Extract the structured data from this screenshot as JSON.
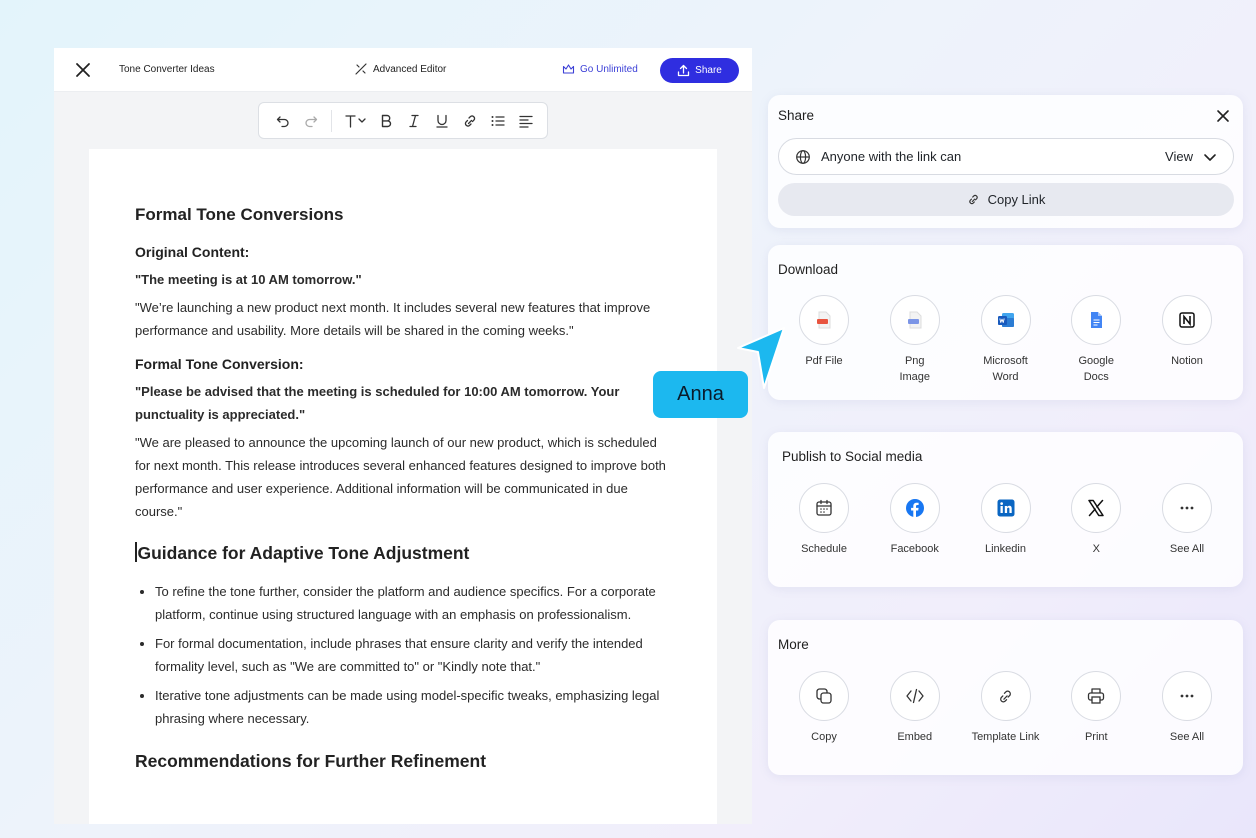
{
  "editor": {
    "doc_title": "Tone Converter Ideas",
    "advanced_editor": "Advanced Editor",
    "go_unlimited": "Go Unlimited",
    "share": "Share"
  },
  "document": {
    "h_formal": "Formal Tone Conversions",
    "original_heading": "Original Content:",
    "original_quote": "\"The meeting is at 10 AM tomorrow.\"",
    "original_para": "\"We’re launching a new product next month. It includes several new features that improve performance and usability. More details will be shared in the coming weeks.\"",
    "conversion_heading": "Formal Tone Conversion:",
    "conversion_quote": "\"Please be advised that the meeting is scheduled for 10:00 AM tomorrow. Your punctuality is appreciated.\"",
    "conversion_para": "\"We are pleased to announce the upcoming launch of our new product, which is scheduled for next month. This release introduces several enhanced features designed to improve both performance and user experience. Additional information will be communicated in due course.\"",
    "h_guidance": "Guidance for Adaptive Tone Adjustment",
    "bullets": [
      "To refine the tone further, consider the platform and audience specifics. For a corporate platform, continue using structured language with an emphasis on professionalism.",
      "For formal documentation, include phrases that ensure clarity and verify the intended formality level, such as \"We are committed to\" or \"Kindly note that.\"",
      "Iterative tone adjustments can be made using model-specific tweaks, emphasizing legal phrasing where necessary."
    ],
    "h_recommend": "Recommendations for Further Refinement"
  },
  "share_panel": {
    "title": "Share",
    "permission": "Anyone with the link can",
    "permission_value": "View",
    "copy_link": "Copy Link"
  },
  "download": {
    "title": "Download",
    "items": [
      {
        "label": "Pdf File",
        "icon": "pdf-file-icon"
      },
      {
        "label": "Png Image",
        "icon": "png-image-icon"
      },
      {
        "label": "Microsoft Word",
        "icon": "microsoft-word-icon"
      },
      {
        "label": "Google Docs",
        "icon": "google-docs-icon"
      },
      {
        "label": "Notion",
        "icon": "notion-icon"
      }
    ]
  },
  "social": {
    "title": "Publish to Social media",
    "items": [
      {
        "label": "Schedule",
        "icon": "calendar-icon"
      },
      {
        "label": "Facebook",
        "icon": "facebook-icon"
      },
      {
        "label": "Linkedin",
        "icon": "linkedin-icon"
      },
      {
        "label": "X",
        "icon": "x-icon"
      },
      {
        "label": "See All",
        "icon": "more-icon"
      }
    ]
  },
  "more": {
    "title": "More",
    "items": [
      {
        "label": "Copy",
        "icon": "copy-icon"
      },
      {
        "label": "Embed",
        "icon": "code-icon"
      },
      {
        "label": "Template Link",
        "icon": "link-icon"
      },
      {
        "label": "Print",
        "icon": "printer-icon"
      },
      {
        "label": "See All",
        "icon": "more-icon"
      }
    ]
  },
  "collaborator": {
    "name": "Anna"
  },
  "colors": {
    "accent": "#2f2ee0",
    "cursor": "#1cb8ef"
  }
}
